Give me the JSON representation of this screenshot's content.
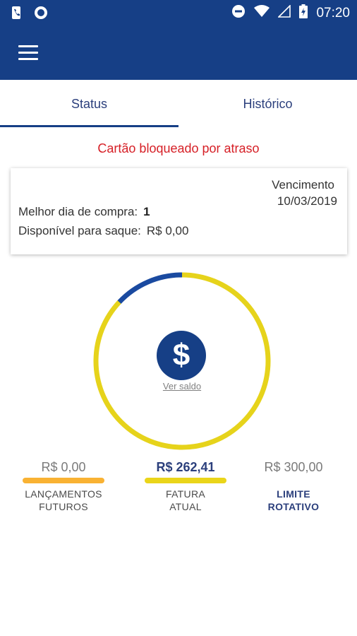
{
  "status_bar": {
    "time": "07:20",
    "left_icons": [
      "phone-notification-icon",
      "circle-notification-icon"
    ],
    "right_icons": [
      "do-not-disturb-icon",
      "wifi-icon",
      "signal-icon",
      "battery-charging-icon"
    ]
  },
  "app_bar": {
    "menu_icon": "hamburger-menu-icon"
  },
  "tabs": [
    {
      "label": "Status",
      "selected": true
    },
    {
      "label": "Histórico",
      "selected": false
    }
  ],
  "alert": "Cartão bloqueado por atraso",
  "card": {
    "best_day_label": "Melhor dia de compra:",
    "best_day_value": "1",
    "withdraw_label": "Disponível para saque:",
    "withdraw_value": "R$ 0,00",
    "due_label": "Vencimento",
    "due_date": "10/03/2019"
  },
  "gauge": {
    "icon": "dollar-icon",
    "symbol": "$",
    "link": "Ver saldo",
    "used_fraction": 0.87,
    "colors": {
      "used": "#e6d31b",
      "available": "#1a4aa0"
    }
  },
  "summary": [
    {
      "amount": "R$ 0,00",
      "label_line1": "LANÇAMENTOS",
      "label_line2": "FUTUROS",
      "bar_color": "#f9b233"
    },
    {
      "amount": "R$ 262,41",
      "label_line1": "FATURA",
      "label_line2": "ATUAL",
      "bar_color": "#ead51a"
    },
    {
      "amount": "R$ 300,00",
      "label_line1": "LIMITE",
      "label_line2": "ROTATIVO"
    }
  ],
  "colors": {
    "primary": "#163f86",
    "alert": "#d61f26"
  }
}
